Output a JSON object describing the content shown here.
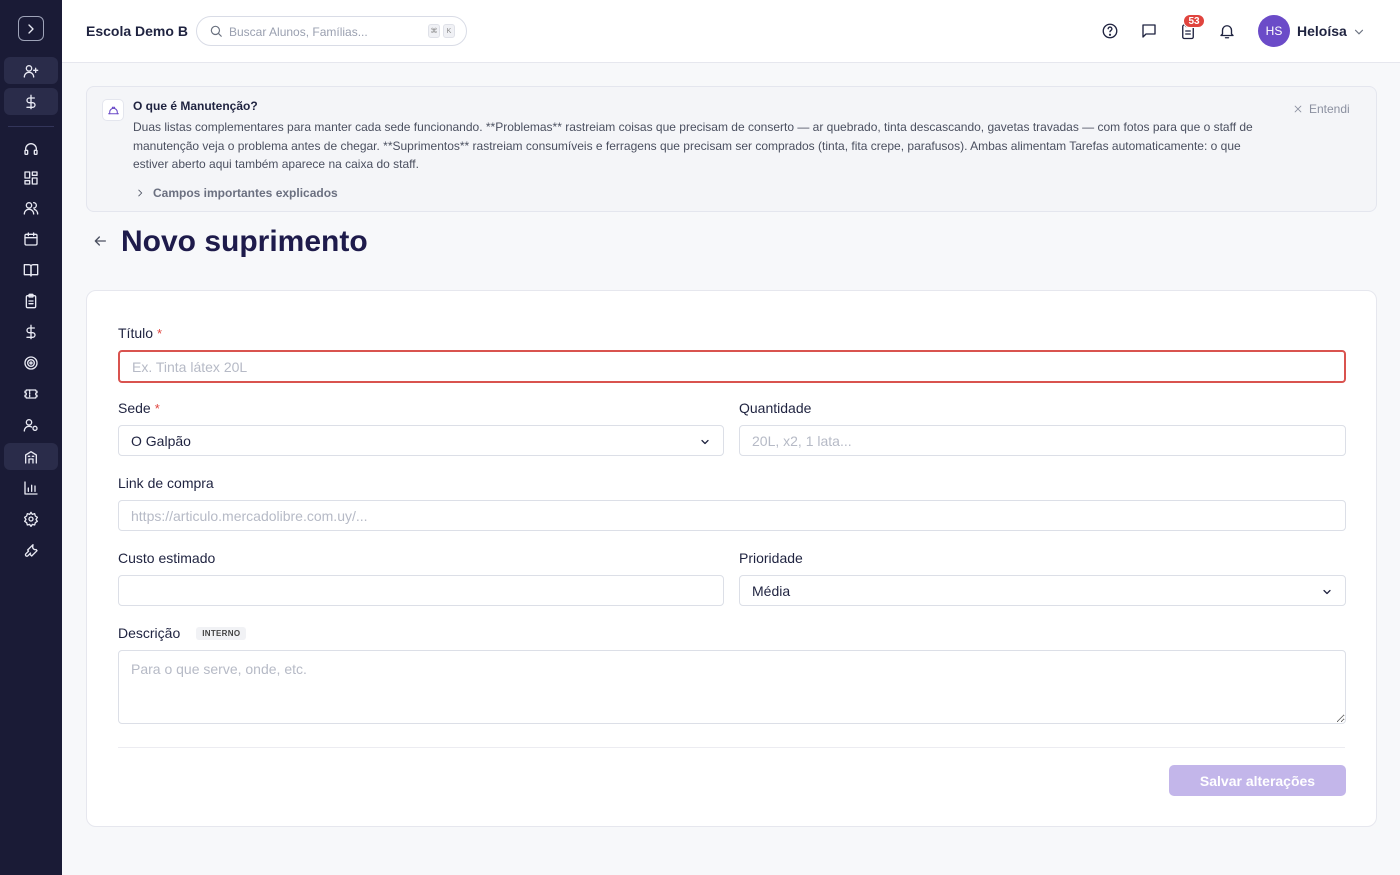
{
  "header": {
    "school": "Escola Demo B",
    "search_placeholder": "Buscar Alunos, Famílias...",
    "kbd1": "⌘",
    "kbd2": "K",
    "notif_count": "53",
    "avatar_initials": "HS",
    "user_name": "Heloísa"
  },
  "banner": {
    "title": "O que é Manutenção?",
    "text": "Duas listas complementares para manter cada sede funcionando. **Problemas** rastreiam coisas que precisam de conserto — ar quebrado, tinta descascando, gavetas travadas — com fotos para que o staff de manutenção veja o problema antes de chegar. **Suprimentos** rastreiam consumíveis e ferragens que precisam ser comprados (tinta, fita crepe, parafusos). Ambas alimentam Tarefas automaticamente: o que estiver aberto aqui também aparece na caixa do staff.",
    "dismiss": "Entendi",
    "more": "Campos importantes explicados"
  },
  "page": {
    "title": "Novo suprimento"
  },
  "form": {
    "titulo_label": "Título",
    "titulo_placeholder": "Ex. Tinta látex 20L",
    "sede_label": "Sede",
    "sede_value": "O Galpão",
    "quantidade_label": "Quantidade",
    "quantidade_placeholder": "20L, x2, 1 lata...",
    "link_label": "Link de compra",
    "link_placeholder": "https://articulo.mercadolibre.com.uy/...",
    "custo_label": "Custo estimado",
    "prioridade_label": "Prioridade",
    "prioridade_value": "Média",
    "descricao_label": "Descrição",
    "descricao_tag": "INTERNO",
    "descricao_placeholder": "Para o que serve, onde, etc.",
    "required_mark": "*",
    "save_label": "Salvar alterações"
  },
  "colors": {
    "sidebar": "#1a1b36",
    "accent": "#6b4bc8",
    "save_disabled": "#c3b6ea",
    "error": "#d9534f",
    "badge": "#e0443e"
  }
}
